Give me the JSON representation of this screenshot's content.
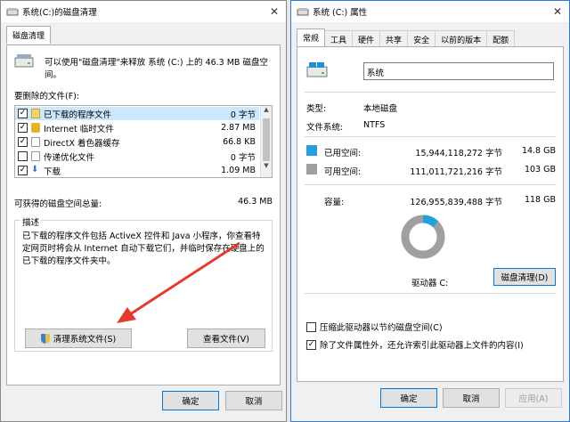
{
  "left": {
    "title": "系统(C:)的磁盘清理",
    "tab": "磁盘清理",
    "intro": "可以使用\"磁盘清理\"来释放 系统 (C:) 上的 46.3 MB 磁盘空间。",
    "files_label": "要删除的文件(F):",
    "files": [
      {
        "name": "已下载的程序文件",
        "size": "0 字节",
        "checked": true,
        "icon": "folder-icon"
      },
      {
        "name": "Internet 临时文件",
        "size": "2.87 MB",
        "checked": true,
        "icon": "lock-icon"
      },
      {
        "name": "DirectX 着色器缓存",
        "size": "66.8 KB",
        "checked": true,
        "icon": "file-icon"
      },
      {
        "name": "传递优化文件",
        "size": "0 字节",
        "checked": false,
        "icon": "file-icon"
      },
      {
        "name": "下载",
        "size": "1.09 MB",
        "checked": true,
        "icon": "download-icon"
      }
    ],
    "total_label": "可获得的磁盘空间总量:",
    "total_value": "46.3 MB",
    "desc_title": "描述",
    "desc_text": "已下载的程序文件包括 ActiveX 控件和 Java 小程序，你查看特定网页时将会从 Internet 自动下载它们，并临时保存在硬盘上的已下载的程序文件夹中。",
    "cleanup_btn": "清理系统文件(S)",
    "view_btn": "查看文件(V)",
    "ok_btn": "确定",
    "cancel_btn": "取消"
  },
  "right": {
    "title": "系统 (C:) 属性",
    "tabs": [
      "常规",
      "工具",
      "硬件",
      "共享",
      "安全",
      "以前的版本",
      "配额"
    ],
    "name_value": "系统",
    "type_label": "类型:",
    "type_value": "本地磁盘",
    "fs_label": "文件系统:",
    "fs_value": "NTFS",
    "used_label": "已用空间:",
    "used_bytes": "15,944,118,272 字节",
    "used_size": "14.8 GB",
    "free_label": "可用空间:",
    "free_bytes": "111,011,721,216 字节",
    "free_size": "103 GB",
    "cap_label": "容量:",
    "cap_bytes": "126,955,839,488 字节",
    "cap_size": "118 GB",
    "drive_label": "驱动器 C:",
    "cleanup_btn": "磁盘清理(D)",
    "compress_label": "压缩此驱动器以节约磁盘空间(C)",
    "compress_checked": false,
    "index_label": "除了文件属性外，还允许索引此驱动器上文件的内容(I)",
    "index_checked": true,
    "ok_btn": "确定",
    "cancel_btn": "取消",
    "apply_btn": "应用(A)",
    "used_fraction": 0.1256,
    "used_color": "#26a0da",
    "free_color": "#a0a0a0"
  }
}
